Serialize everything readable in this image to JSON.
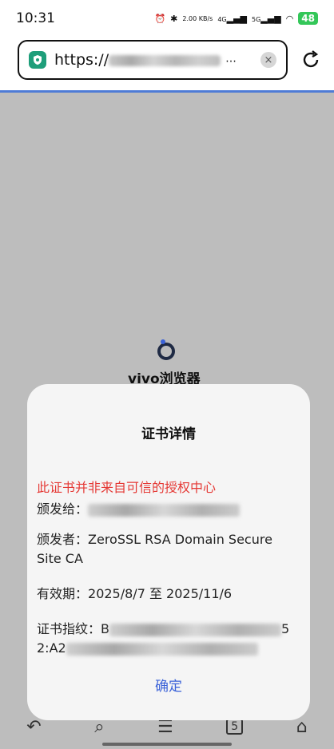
{
  "status": {
    "time": "10:31",
    "network_labels": [
      "2.00 KB/s",
      "4G",
      "5G"
    ],
    "battery": "48"
  },
  "browser": {
    "url_prefix": "https://",
    "url_masked": "⋯",
    "brand": "vivo浏览器"
  },
  "dialog": {
    "title": "证书详情",
    "warning": "此证书并非来自可信的授权中心",
    "issued_to_label": "颁发给：",
    "issuer_label": "颁发者：",
    "issuer_value": "ZeroSSL RSA Domain Secure Site CA",
    "validity_label": "有效期：",
    "validity_value": "2025/8/7 至 2025/11/6",
    "fingerprint_label": "证书指纹：",
    "fingerprint_prefix": "B",
    "fingerprint_suffix": "5",
    "fingerprint_line2_prefix": "2:A2",
    "confirm_label": "确定"
  },
  "nav": {
    "tab_count": "5"
  },
  "colors": {
    "accent": "#3b62d8",
    "warning": "#e53935",
    "secure": "#1e9e7a",
    "progress": "#4e7bd6"
  }
}
